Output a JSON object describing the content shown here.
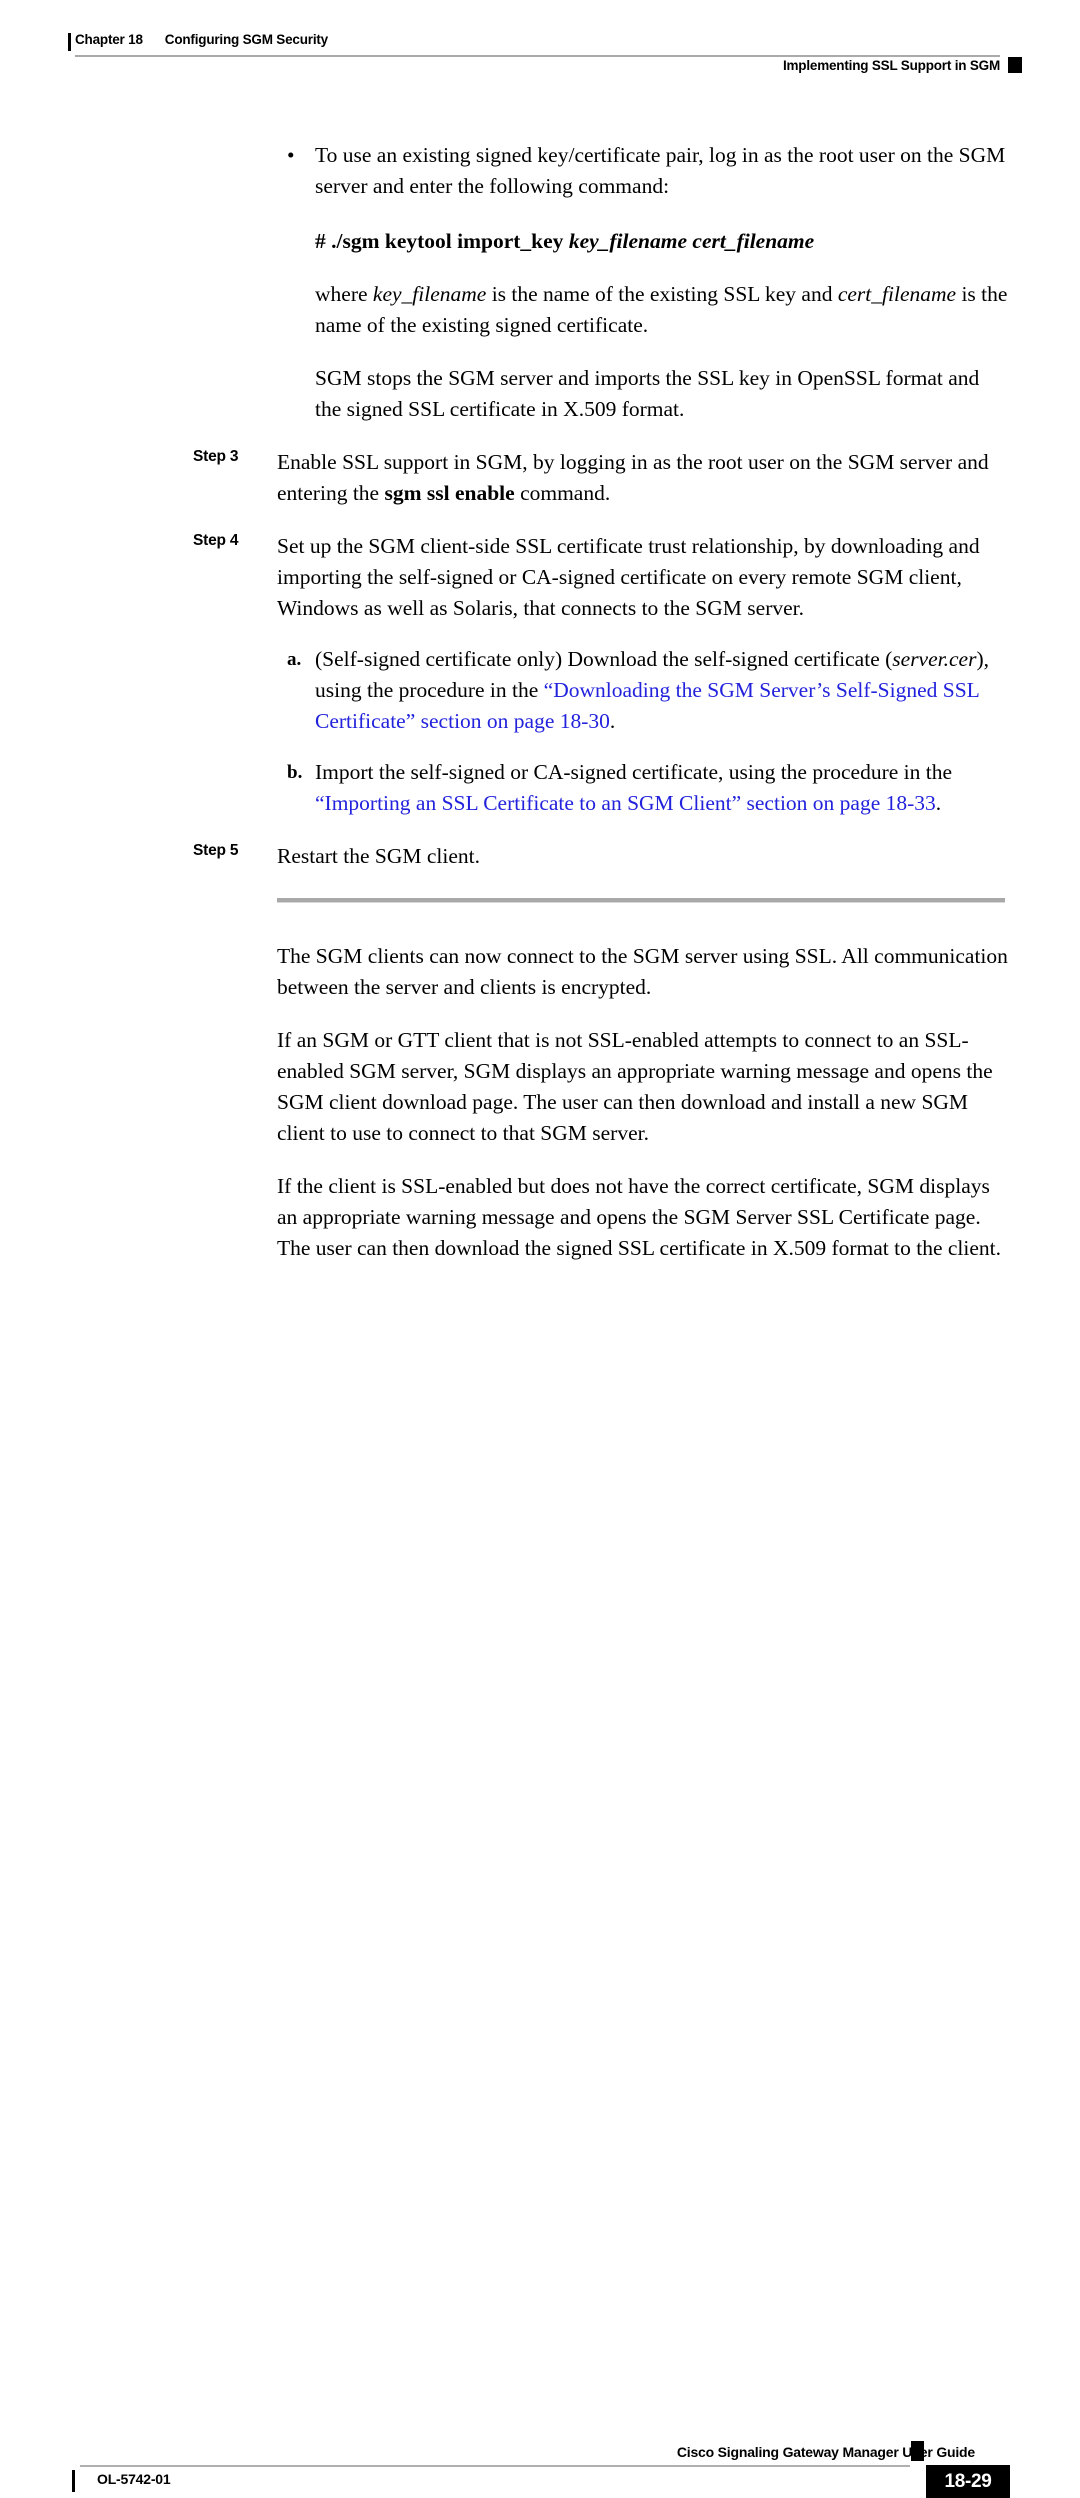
{
  "header": {
    "chapter": "Chapter 18",
    "chapter_title": "Configuring SGM Security",
    "section_title": "Implementing SSL Support in SGM"
  },
  "content": {
    "bullet": {
      "marker": "•",
      "text": "To use an existing signed key/certificate pair, log in as the root user on the SGM server and enter the following command:"
    },
    "command": {
      "command_text": "# ./sgm keytool import_key ",
      "arguments": "key_filename cert_filename"
    },
    "where_para": {
      "part1": "where ",
      "arg1": "key_filename",
      "part2": " is the name of the existing SSL key and ",
      "arg2": "cert_filename",
      "part3": " is the name of the existing signed certificate."
    },
    "result_para": "SGM stops the SGM server and imports the SSL key in OpenSSL format and the signed SSL certificate in X.509 format.",
    "steps": [
      {
        "label": "Step 3",
        "text_before": "Enable SSL support in SGM, by logging in as the root user on the SGM server and entering the ",
        "bold_command": "sgm ssl enable",
        "text_after": " command."
      },
      {
        "label": "Step 4",
        "text": "Set up the SGM client-side SSL certificate trust relationship, by downloading and importing the self-signed or CA-signed certificate on every remote SGM client, Windows as well as Solaris, that connects to the SGM server."
      },
      {
        "label": "Step 5",
        "text": "Restart the SGM client."
      }
    ],
    "substeps": [
      {
        "marker": "a.",
        "part1": "(Self-signed certificate only) Download the self-signed certificate (",
        "italic": "server.cer",
        "part2": "), using the procedure in the ",
        "link": "“Downloading the SGM Server’s Self-Signed SSL Certificate” section on page 18-30",
        "part3": "."
      },
      {
        "marker": "b.",
        "part1": "Import the self-signed or CA-signed certificate, using the procedure in the ",
        "italic": "",
        "part2": "",
        "link": "“Importing an SSL Certificate to an SGM Client” section on page 18-33",
        "part3": "."
      }
    ],
    "closing_paragraphs": [
      "The SGM clients can now connect to the SGM server using SSL. All communication between the server and clients is encrypted.",
      "If an SGM or GTT client that is not SSL-enabled attempts to connect to an SSL-enabled SGM server, SGM displays an appropriate warning message and opens the SGM client download page. The user can then download and install a new SGM client to use to connect to that SGM server.",
      "If the client is SSL-enabled but does not have the correct certificate, SGM displays an appropriate warning message and opens the SGM Server SSL Certificate page. The user can then download the signed SSL certificate in X.509 format to the client."
    ]
  },
  "footer": {
    "guide_title": "Cisco Signaling Gateway Manager User Guide",
    "doc_id": "OL-5742-01",
    "page_number": "18-29"
  },
  "colors": {
    "link": "#2222dd",
    "rule": "#a8a8a8",
    "text": "#000000"
  }
}
